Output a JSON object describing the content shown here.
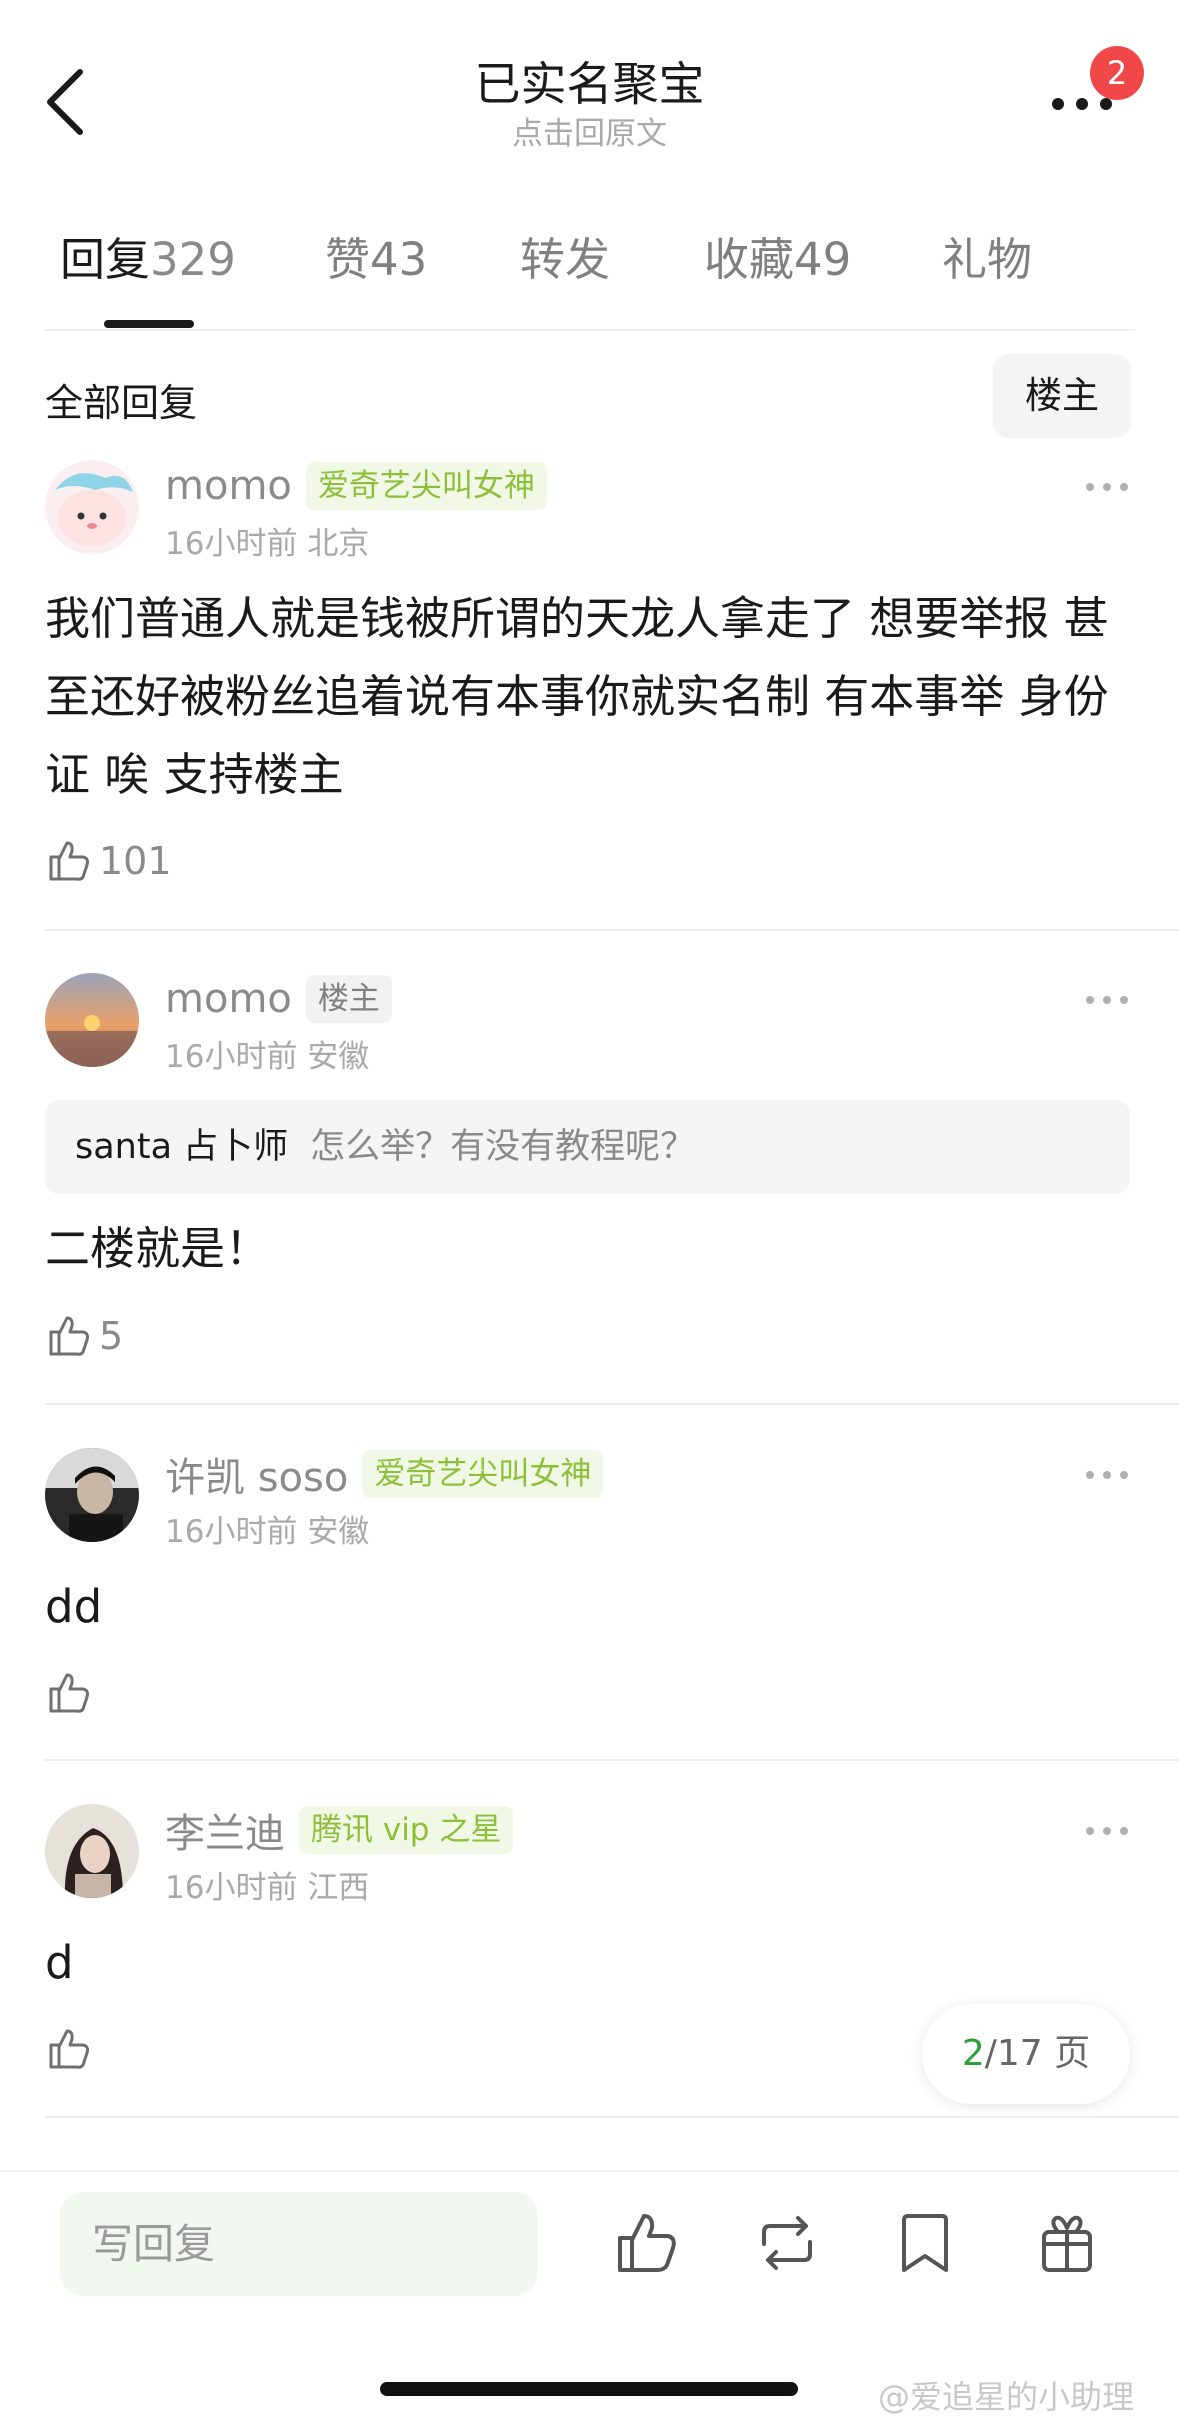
{
  "header": {
    "title": "已实名聚宝",
    "subtitle": "点击回原文",
    "badge_count": "2"
  },
  "tabs": [
    {
      "label": "回复",
      "count": "329",
      "active": true
    },
    {
      "label": "赞",
      "count": "43",
      "active": false
    },
    {
      "label": "转发",
      "count": "",
      "active": false
    },
    {
      "label": "收藏",
      "count": "49",
      "active": false
    },
    {
      "label": "礼物",
      "count": "",
      "active": false
    }
  ],
  "section": {
    "title": "全部回复",
    "filter_label": "楼主"
  },
  "comments": [
    {
      "user": "momo",
      "tag": "爱奇艺尖叫女神",
      "tag_style": "green",
      "time": "16小时前",
      "location": "北京",
      "text": "我们普通人就是钱被所谓的天龙人拿走了 想要举报 甚至还好被粉丝追着说有本事你就实名制 有本事举 身份证  唉 支持楼主",
      "likes": "101"
    },
    {
      "user": "momo",
      "tag": "楼主",
      "tag_style": "gray",
      "time": "16小时前",
      "location": "安徽",
      "quote_user": "santa 占卜师",
      "quote_text": "怎么举？有没有教程呢？",
      "text": "二楼就是！",
      "likes": "5"
    },
    {
      "user": "许凯 soso",
      "tag": "爱奇艺尖叫女神",
      "tag_style": "green",
      "time": "16小时前",
      "location": "安徽",
      "text": "dd",
      "likes": ""
    },
    {
      "user": "李兰迪",
      "tag": "腾讯 vip 之星",
      "tag_style": "green",
      "time": "16小时前",
      "location": "江西",
      "text": "d",
      "likes": ""
    }
  ],
  "pagination": {
    "current": "2",
    "total_text": "/17 页"
  },
  "bottom_bar": {
    "reply_placeholder": "写回复",
    "icons": [
      "like-icon",
      "repost-icon",
      "bookmark-icon",
      "gift-icon"
    ]
  },
  "watermark": "@爱追星的小助理",
  "colors": {
    "tag_green_text": "#8cc03a",
    "tag_green_bg": "#f1f8e6",
    "badge_red": "#f04848",
    "page_current_green": "#2e9e3a",
    "reply_input_bg": "#f1f8ef"
  }
}
